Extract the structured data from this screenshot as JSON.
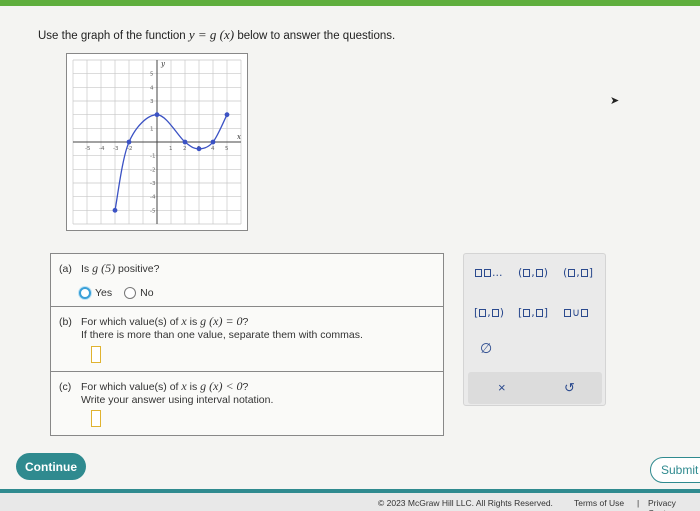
{
  "prompt": {
    "before": "Use the graph of the function ",
    "func": "y = g (x)",
    "after": " below to answer the questions."
  },
  "graph": {
    "x_axis_label": "x",
    "y_axis_label": "y",
    "x_ticks": [
      "-5",
      "-4",
      "-3",
      "-2",
      "1",
      "2",
      "3",
      "4",
      "5"
    ],
    "y_ticks": [
      "5",
      "4",
      "3",
      "1",
      "-1",
      "-2",
      "-3",
      "-4",
      "-5"
    ],
    "curve_points": [
      [
        -3,
        -5
      ],
      [
        -2,
        0
      ],
      [
        0,
        2
      ],
      [
        2,
        0
      ],
      [
        3,
        -0.5
      ],
      [
        4,
        0
      ],
      [
        5,
        2
      ]
    ],
    "solid_points": [
      [
        -3,
        -5
      ],
      [
        -2,
        0
      ],
      [
        0,
        2
      ],
      [
        2,
        0
      ],
      [
        3,
        -0.5
      ],
      [
        4,
        0
      ],
      [
        5,
        2
      ]
    ],
    "xlim": [
      -6,
      6
    ],
    "ylim": [
      -6,
      6
    ]
  },
  "q_a": {
    "label": "(a)",
    "text_before": "Is ",
    "expr": "g (5)",
    "text_after": " positive?",
    "yes": "Yes",
    "no": "No"
  },
  "q_b": {
    "label": "(b)",
    "text_before": "For which value(s) of ",
    "xvar": "x",
    "text_mid": " is ",
    "expr": "g (x) = 0",
    "text_after": "?",
    "line2": "If there is more than one value, separate them with commas."
  },
  "q_c": {
    "label": "(c)",
    "text_before": "For which value(s) of ",
    "xvar": "x",
    "text_mid": " is ",
    "expr": "g (x) < 0",
    "text_after": "?",
    "line2": "Write your answer using interval notation."
  },
  "palette": {
    "ellipsis": "...",
    "empty_set": "∅",
    "clear": "×",
    "undo": "↺"
  },
  "buttons": {
    "continue": "Continue",
    "submit": "Submit"
  },
  "footer": {
    "copyright": "© 2023 McGraw Hill LLC. All Rights Reserved.",
    "terms": "Terms of Use",
    "separator": "|",
    "privacy": "Privacy Center"
  },
  "colors": {
    "accent": "#2f8a8f",
    "curve": "#3b52c4",
    "top_bar": "#5fae3e",
    "answer_box": "#e0b330"
  }
}
